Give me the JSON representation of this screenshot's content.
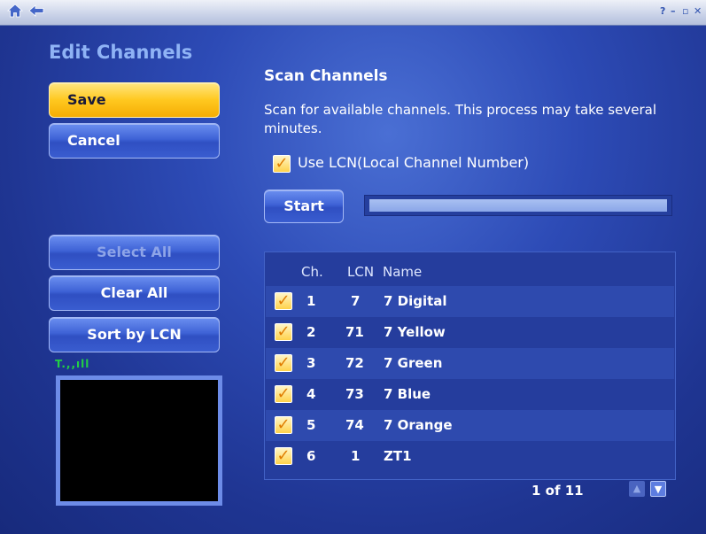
{
  "titlebar": {
    "home_icon": "home-icon",
    "back_icon": "back-arrow-icon",
    "help": "?",
    "minimize": "–",
    "restore": "▫",
    "close": "✕"
  },
  "sidebar": {
    "title": "Edit Channels",
    "save_label": "Save",
    "cancel_label": "Cancel",
    "select_all_label": "Select All",
    "clear_all_label": "Clear All",
    "sort_by_lcn_label": "Sort by LCN",
    "signal": "T.,,ıll"
  },
  "scan": {
    "title": "Scan Channels",
    "description": "Scan for available channels. This process may take several minutes.",
    "use_lcn_label": "Use LCN(Local Channel Number)",
    "use_lcn_checked": true,
    "start_label": "Start"
  },
  "channels": {
    "headers": {
      "ch": "Ch.",
      "lcn": "LCN",
      "name": "Name"
    },
    "rows": [
      {
        "checked": true,
        "ch": "1",
        "lcn": "7",
        "name": "7 Digital"
      },
      {
        "checked": true,
        "ch": "2",
        "lcn": "71",
        "name": "7 Yellow"
      },
      {
        "checked": true,
        "ch": "3",
        "lcn": "72",
        "name": "7 Green"
      },
      {
        "checked": true,
        "ch": "4",
        "lcn": "73",
        "name": "7 Blue"
      },
      {
        "checked": true,
        "ch": "5",
        "lcn": "74",
        "name": "7 Orange"
      },
      {
        "checked": true,
        "ch": "6",
        "lcn": "1",
        "name": "ZT1"
      }
    ],
    "pager": "1 of 11"
  },
  "colors": {
    "accent_yellow": "#ffc81f",
    "background_blue": "#2d4bb6",
    "signal_green": "#22d144"
  }
}
